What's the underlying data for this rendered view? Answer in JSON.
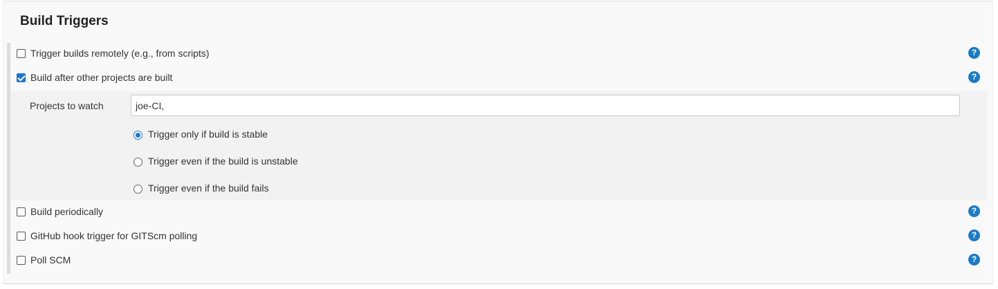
{
  "section": {
    "title": "Build Triggers"
  },
  "triggers": [
    {
      "label": "Trigger builds remotely (e.g., from scripts)",
      "checked": false,
      "help": "?"
    },
    {
      "label": "Build after other projects are built",
      "checked": true,
      "help": "?"
    },
    {
      "label": "Build periodically",
      "checked": false,
      "help": "?"
    },
    {
      "label": "GitHub hook trigger for GITScm polling",
      "checked": false,
      "help": "?"
    },
    {
      "label": "Poll SCM",
      "checked": false,
      "help": "?"
    }
  ],
  "build_after": {
    "projects_label": "Projects to watch",
    "projects_value": "joe-CI,",
    "options": [
      {
        "label": "Trigger only if build is stable",
        "selected": true
      },
      {
        "label": "Trigger even if the build is unstable",
        "selected": false
      },
      {
        "label": "Trigger even if the build fails",
        "selected": false
      }
    ]
  },
  "colors": {
    "accent": "#1976d2",
    "help_icon": "#1a7bc7",
    "panel_bg": "#f9f9f9",
    "nested_bg": "#f2f2f2"
  },
  "icons": {
    "help": "question-circle-icon"
  }
}
